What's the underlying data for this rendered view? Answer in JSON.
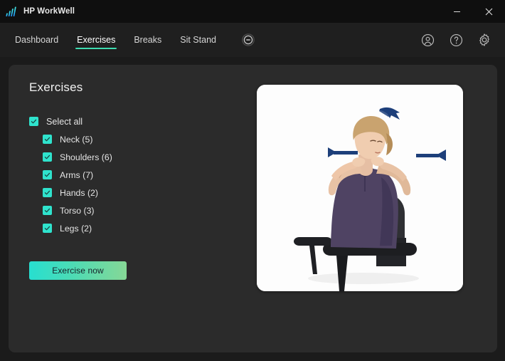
{
  "window": {
    "title": "HP WorkWell",
    "logo_icon": "bars-logo-icon",
    "minimize_label": "—",
    "close_label": "✕",
    "minimize_icon": "minimize-icon",
    "close_icon": "close-icon"
  },
  "nav": {
    "tabs": [
      {
        "label": "Dashboard",
        "active": false
      },
      {
        "label": "Exercises",
        "active": true
      },
      {
        "label": "Breaks",
        "active": false
      },
      {
        "label": "Sit Stand",
        "active": false
      }
    ],
    "status_icon": "pause-circle-icon",
    "actions": [
      {
        "icon": "account-icon"
      },
      {
        "icon": "help-icon"
      },
      {
        "icon": "gear-icon"
      }
    ]
  },
  "main": {
    "title": "Exercises",
    "select_all": {
      "label": "Select all",
      "checked": true
    },
    "categories": [
      {
        "label": "Neck (5)",
        "checked": true
      },
      {
        "label": "Shoulders (6)",
        "checked": true
      },
      {
        "label": "Arms (7)",
        "checked": true
      },
      {
        "label": "Hands (2)",
        "checked": true
      },
      {
        "label": "Torso (3)",
        "checked": true
      },
      {
        "label": "Legs (2)",
        "checked": true
      }
    ],
    "primary_button": "Exercise now",
    "preview": {
      "alt": "Seated woman performing a neck and shoulder stretch with hands behind head, blue direction arrows",
      "image_name": "exercise-preview-image"
    }
  },
  "colors": {
    "accent": "#2fe3cd",
    "accent_underline": "#3ddcb0",
    "button_gradient_start": "#27dfd0",
    "button_gradient_end": "#86d896",
    "window_bg": "#1b1b1b",
    "titlebar_bg": "#0f0f0f",
    "navbar_bg": "#1f1f1f",
    "panel_bg": "#2b2b2b",
    "text_primary": "#f2f2f2",
    "arrow_blue": "#1d3f7a"
  }
}
